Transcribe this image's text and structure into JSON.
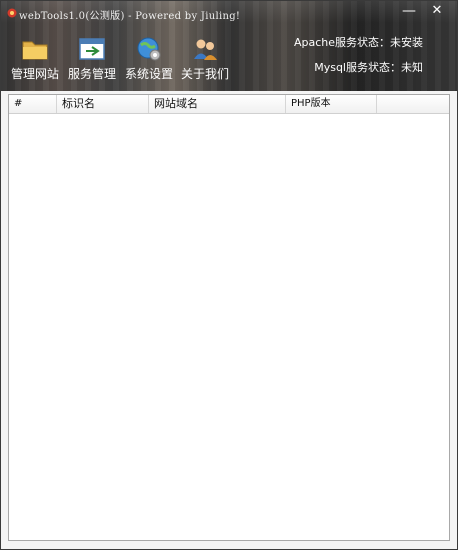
{
  "window": {
    "title": "webTools1.0(公测版) - Powered by Jiuling!",
    "minimize_label": "—",
    "close_label": "✕"
  },
  "toolbar": {
    "items": [
      {
        "label": "管理网站",
        "icon": "folder-icon"
      },
      {
        "label": "服务管理",
        "icon": "service-icon"
      },
      {
        "label": "系统设置",
        "icon": "settings-globe-icon"
      },
      {
        "label": "关于我们",
        "icon": "users-icon"
      }
    ]
  },
  "status": {
    "apache": "Apache服务状态：未安装",
    "mysql": "Mysql服务状态：未知"
  },
  "table": {
    "columns": [
      "#",
      "标识名",
      "网站域名",
      "PHP版本"
    ],
    "rows": []
  }
}
